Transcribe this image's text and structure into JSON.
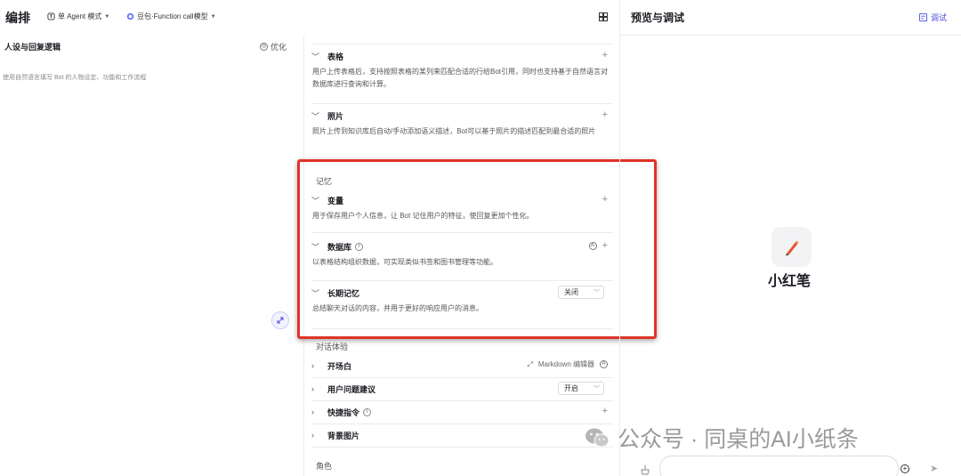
{
  "topbar": {
    "title": "编排",
    "mode_label": "单 Agent 模式",
    "model_label": "豆包·Function call模型"
  },
  "persona": {
    "heading": "人设与回复逻辑",
    "optimize_label": "优化",
    "placeholder": "使用自然语言填写 Bot 的人物设定、功能和工作流程"
  },
  "config": {
    "table": {
      "name": "表格",
      "desc": "用户上传表格后，支持按照表格的某列来匹配合适的行给Bot引用，同时也支持基于自然语言对数据库进行查询和计算。"
    },
    "photo": {
      "name": "照片",
      "desc": "照片上传到知识库后自动/手动添加语义描述，Bot可以基于照片的描述匹配到最合适的照片"
    },
    "memory_group": "记忆",
    "variables": {
      "name": "变量",
      "desc": "用于保存用户个人信息，让 Bot 记住用户的特征，使回复更加个性化。"
    },
    "database": {
      "name": "数据库",
      "desc": "以表格结构组织数据，可实现类似书签和图书管理等功能。"
    },
    "long_memory": {
      "name": "长期记忆",
      "select_value": "关闭",
      "desc": "总结聊天对话的内容，并用于更好的响应用户的消息。"
    },
    "dialog_group": "对话体验",
    "opening": {
      "name": "开场白",
      "tool": "Markdown 编辑器"
    },
    "suggestions": {
      "name": "用户问题建议",
      "select_value": "开启"
    },
    "shortcuts": {
      "name": "快捷指令"
    },
    "background": {
      "name": "背景图片"
    },
    "role_group": "角色"
  },
  "preview": {
    "title": "预览与调试",
    "debug_label": "调试",
    "bot_name": "小红笔"
  },
  "watermark": {
    "text": "公众号 · 同桌的AI小纸条"
  },
  "colors": {
    "accent": "#4b4ddd",
    "highlight": "#e0332a"
  }
}
